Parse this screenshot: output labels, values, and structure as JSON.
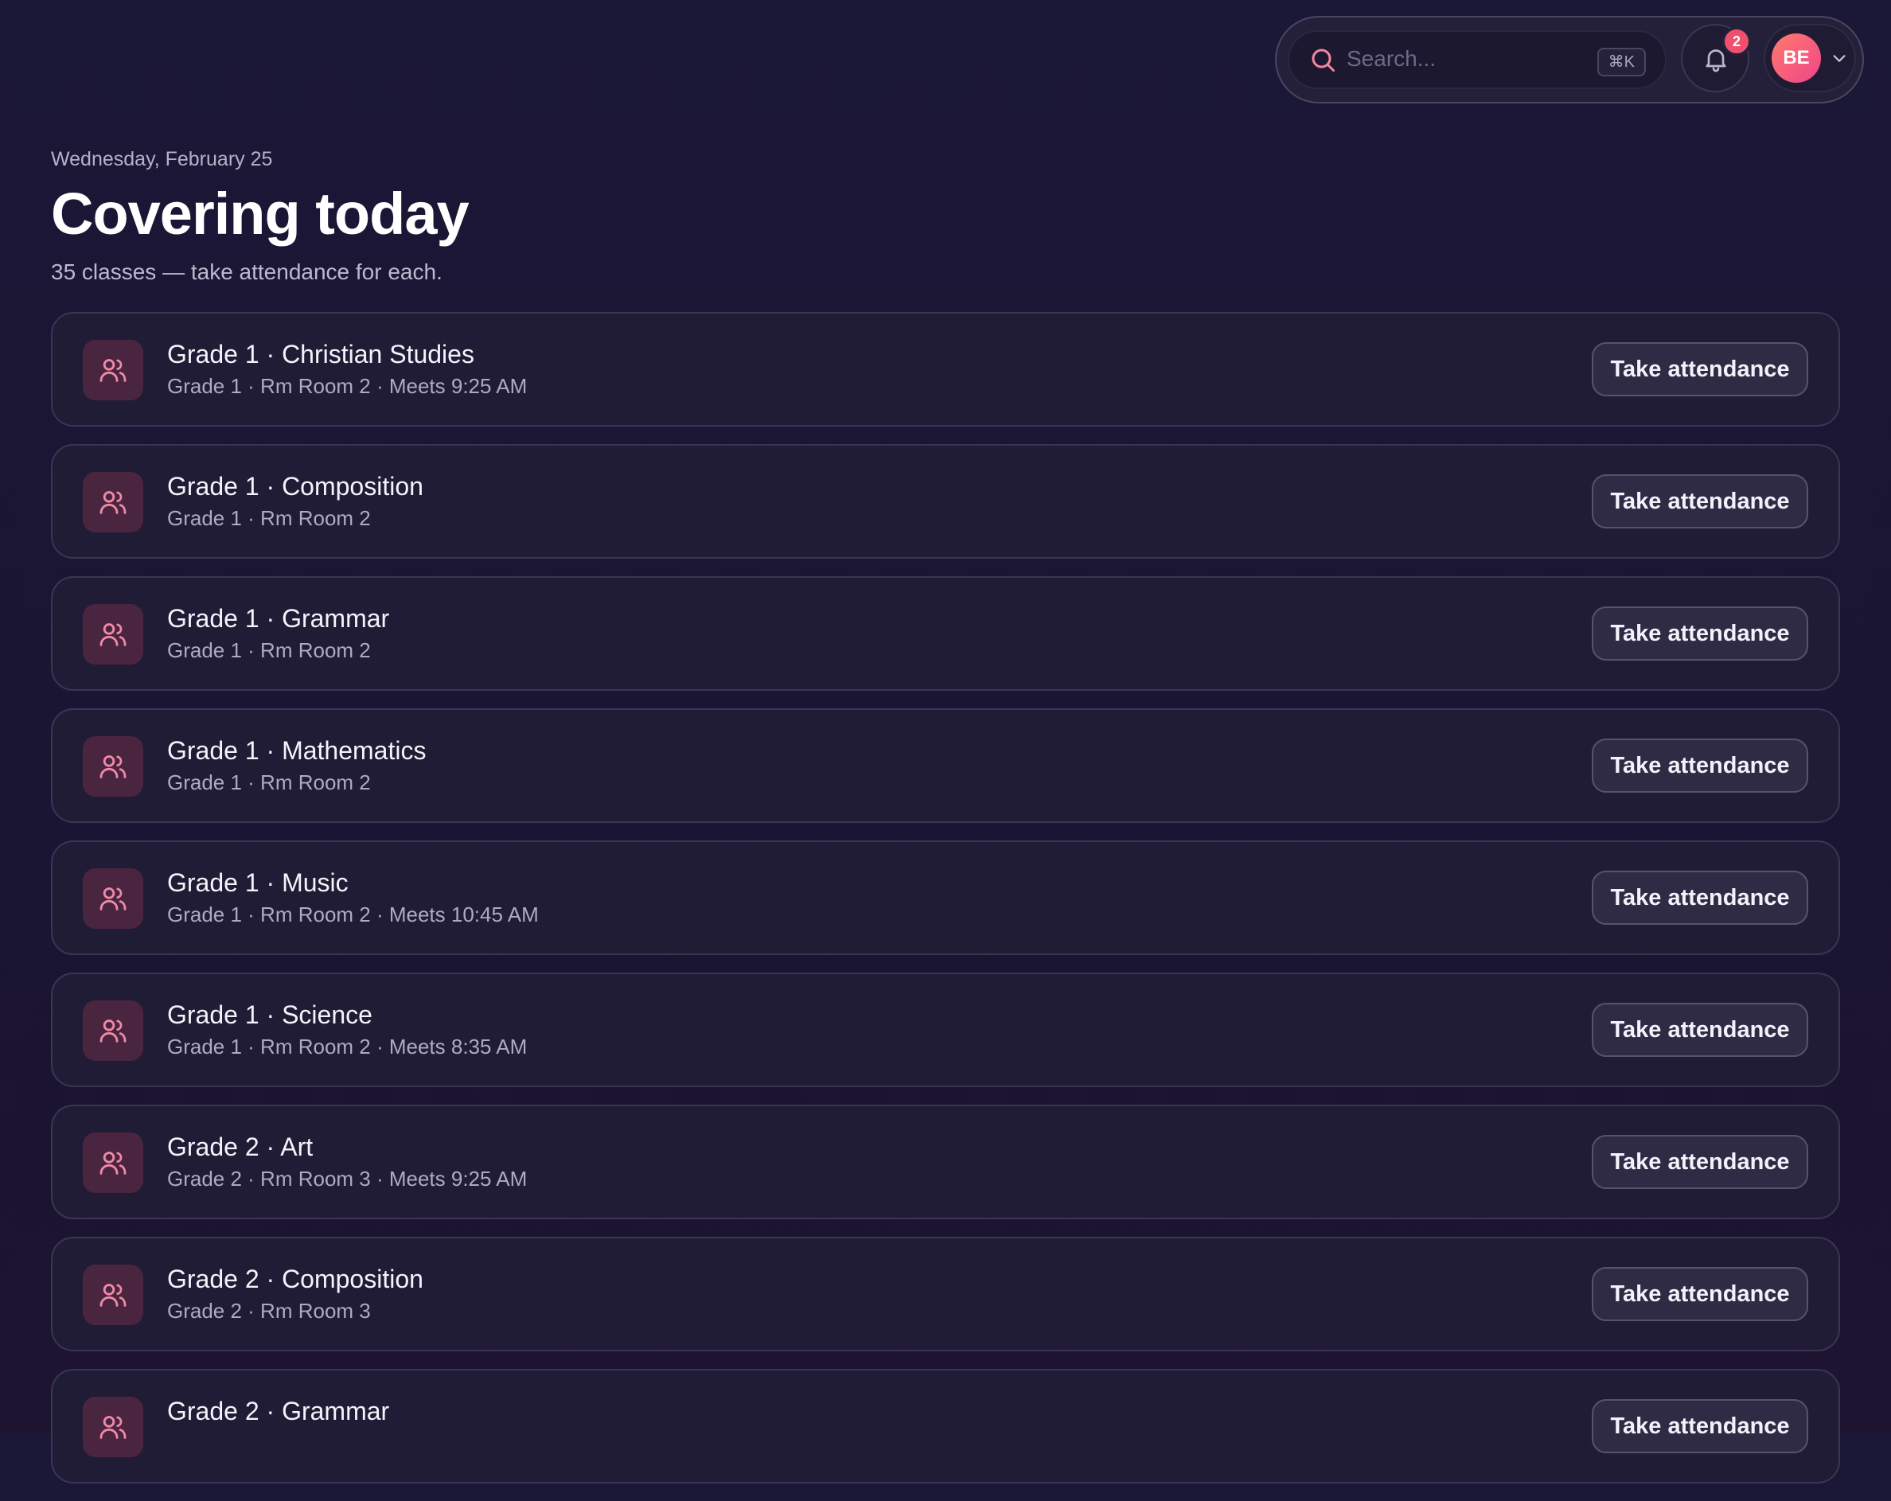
{
  "topbar": {
    "search_placeholder": "Search...",
    "shortcut": "⌘K",
    "notifications_count": "2",
    "user_initials": "BE"
  },
  "header": {
    "date": "Wednesday, February 25",
    "title": "Covering today",
    "subtitle": "35 classes — take attendance for each."
  },
  "classes": [
    {
      "title": "Grade 1 · Christian Studies",
      "meta": "Grade 1 · Rm Room 2 · Meets 9:25 AM",
      "action": "Take attendance"
    },
    {
      "title": "Grade 1 · Composition",
      "meta": "Grade 1 · Rm Room 2",
      "action": "Take attendance"
    },
    {
      "title": "Grade 1 · Grammar",
      "meta": "Grade 1 · Rm Room 2",
      "action": "Take attendance"
    },
    {
      "title": "Grade 1 · Mathematics",
      "meta": "Grade 1 · Rm Room 2",
      "action": "Take attendance"
    },
    {
      "title": "Grade 1 · Music",
      "meta": "Grade 1 · Rm Room 2 · Meets 10:45 AM",
      "action": "Take attendance"
    },
    {
      "title": "Grade 1 · Science",
      "meta": "Grade 1 · Rm Room 2 · Meets 8:35 AM",
      "action": "Take attendance"
    },
    {
      "title": "Grade 2 · Art",
      "meta": "Grade 2 · Rm Room 3 · Meets 9:25 AM",
      "action": "Take attendance"
    },
    {
      "title": "Grade 2 · Composition",
      "meta": "Grade 2 · Rm Room 3",
      "action": "Take attendance"
    },
    {
      "title": "Grade 2 · Grammar",
      "meta": "",
      "action": "Take attendance"
    }
  ],
  "colors": {
    "background": "#1b1736",
    "accent": "#f0506e",
    "card_icon_bg": "#4a2540",
    "icon_stroke": "#f08aa8"
  },
  "icons": {
    "search": "search-icon",
    "notifications": "bell-icon",
    "user_menu": "chevron-down-icon",
    "class": "users-icon"
  }
}
